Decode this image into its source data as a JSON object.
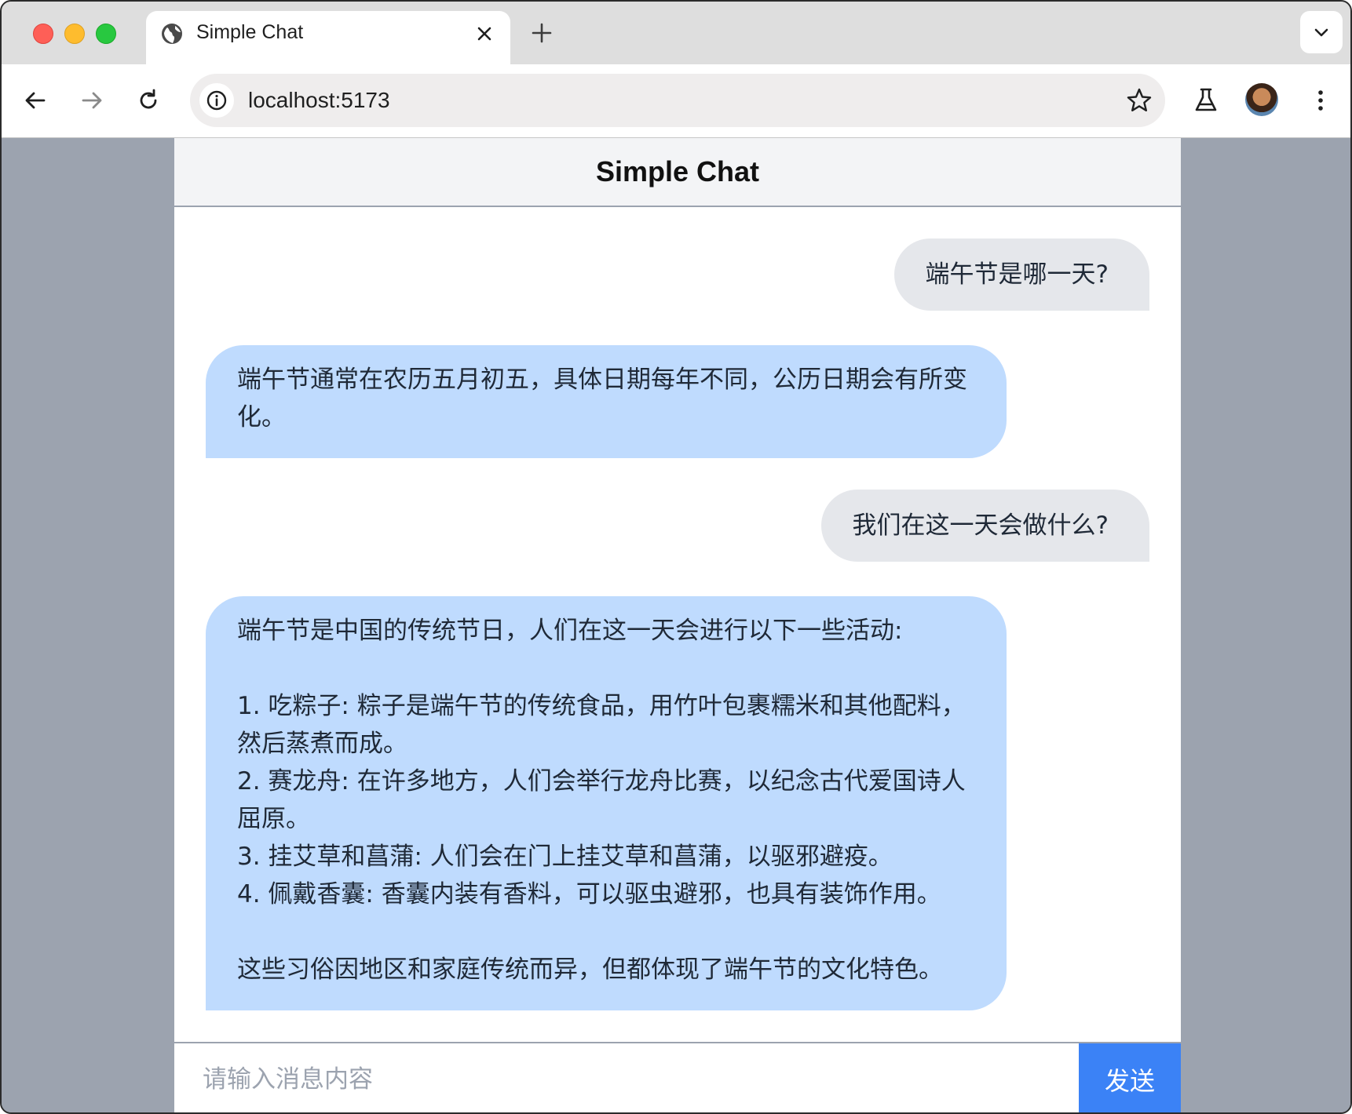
{
  "browser": {
    "tab_title": "Simple Chat",
    "url": "localhost:5173",
    "icons": [
      "globe-icon",
      "close-icon",
      "plus-icon",
      "chevron-down-icon",
      "back-arrow-icon",
      "forward-arrow-icon",
      "reload-icon",
      "info-icon",
      "star-icon",
      "flask-icon",
      "avatar",
      "kebab-menu-icon"
    ]
  },
  "chat": {
    "title": "Simple Chat",
    "messages": [
      {
        "role": "user",
        "text": "端午节是哪一天?"
      },
      {
        "role": "assistant",
        "text": "端午节通常在农历五月初五，具体日期每年不同，公历日期会有所变化。"
      },
      {
        "role": "user",
        "text": "我们在这一天会做什么?"
      },
      {
        "role": "assistant",
        "text": "端午节是中国的传统节日，人们在这一天会进行以下一些活动:\n\n1. 吃粽子: 粽子是端午节的传统食品，用竹叶包裹糯米和其他配料，然后蒸煮而成。\n2. 赛龙舟: 在许多地方，人们会举行龙舟比赛，以纪念古代爱国诗人屈原。\n3. 挂艾草和菖蒲: 人们会在门上挂艾草和菖蒲，以驱邪避疫。\n4. 佩戴香囊: 香囊内装有香料，可以驱虫避邪，也具有装饰作用。\n\n这些习俗因地区和家庭传统而异，但都体现了端午节的文化特色。"
      }
    ],
    "input_placeholder": "请输入消息内容",
    "input_value": "",
    "send_label": "发送"
  },
  "colors": {
    "user_bubble": "#e5e7eb",
    "assistant_bubble": "#bfdbfe",
    "send_button": "#3b82f6",
    "page_background": "#9ca3af"
  }
}
